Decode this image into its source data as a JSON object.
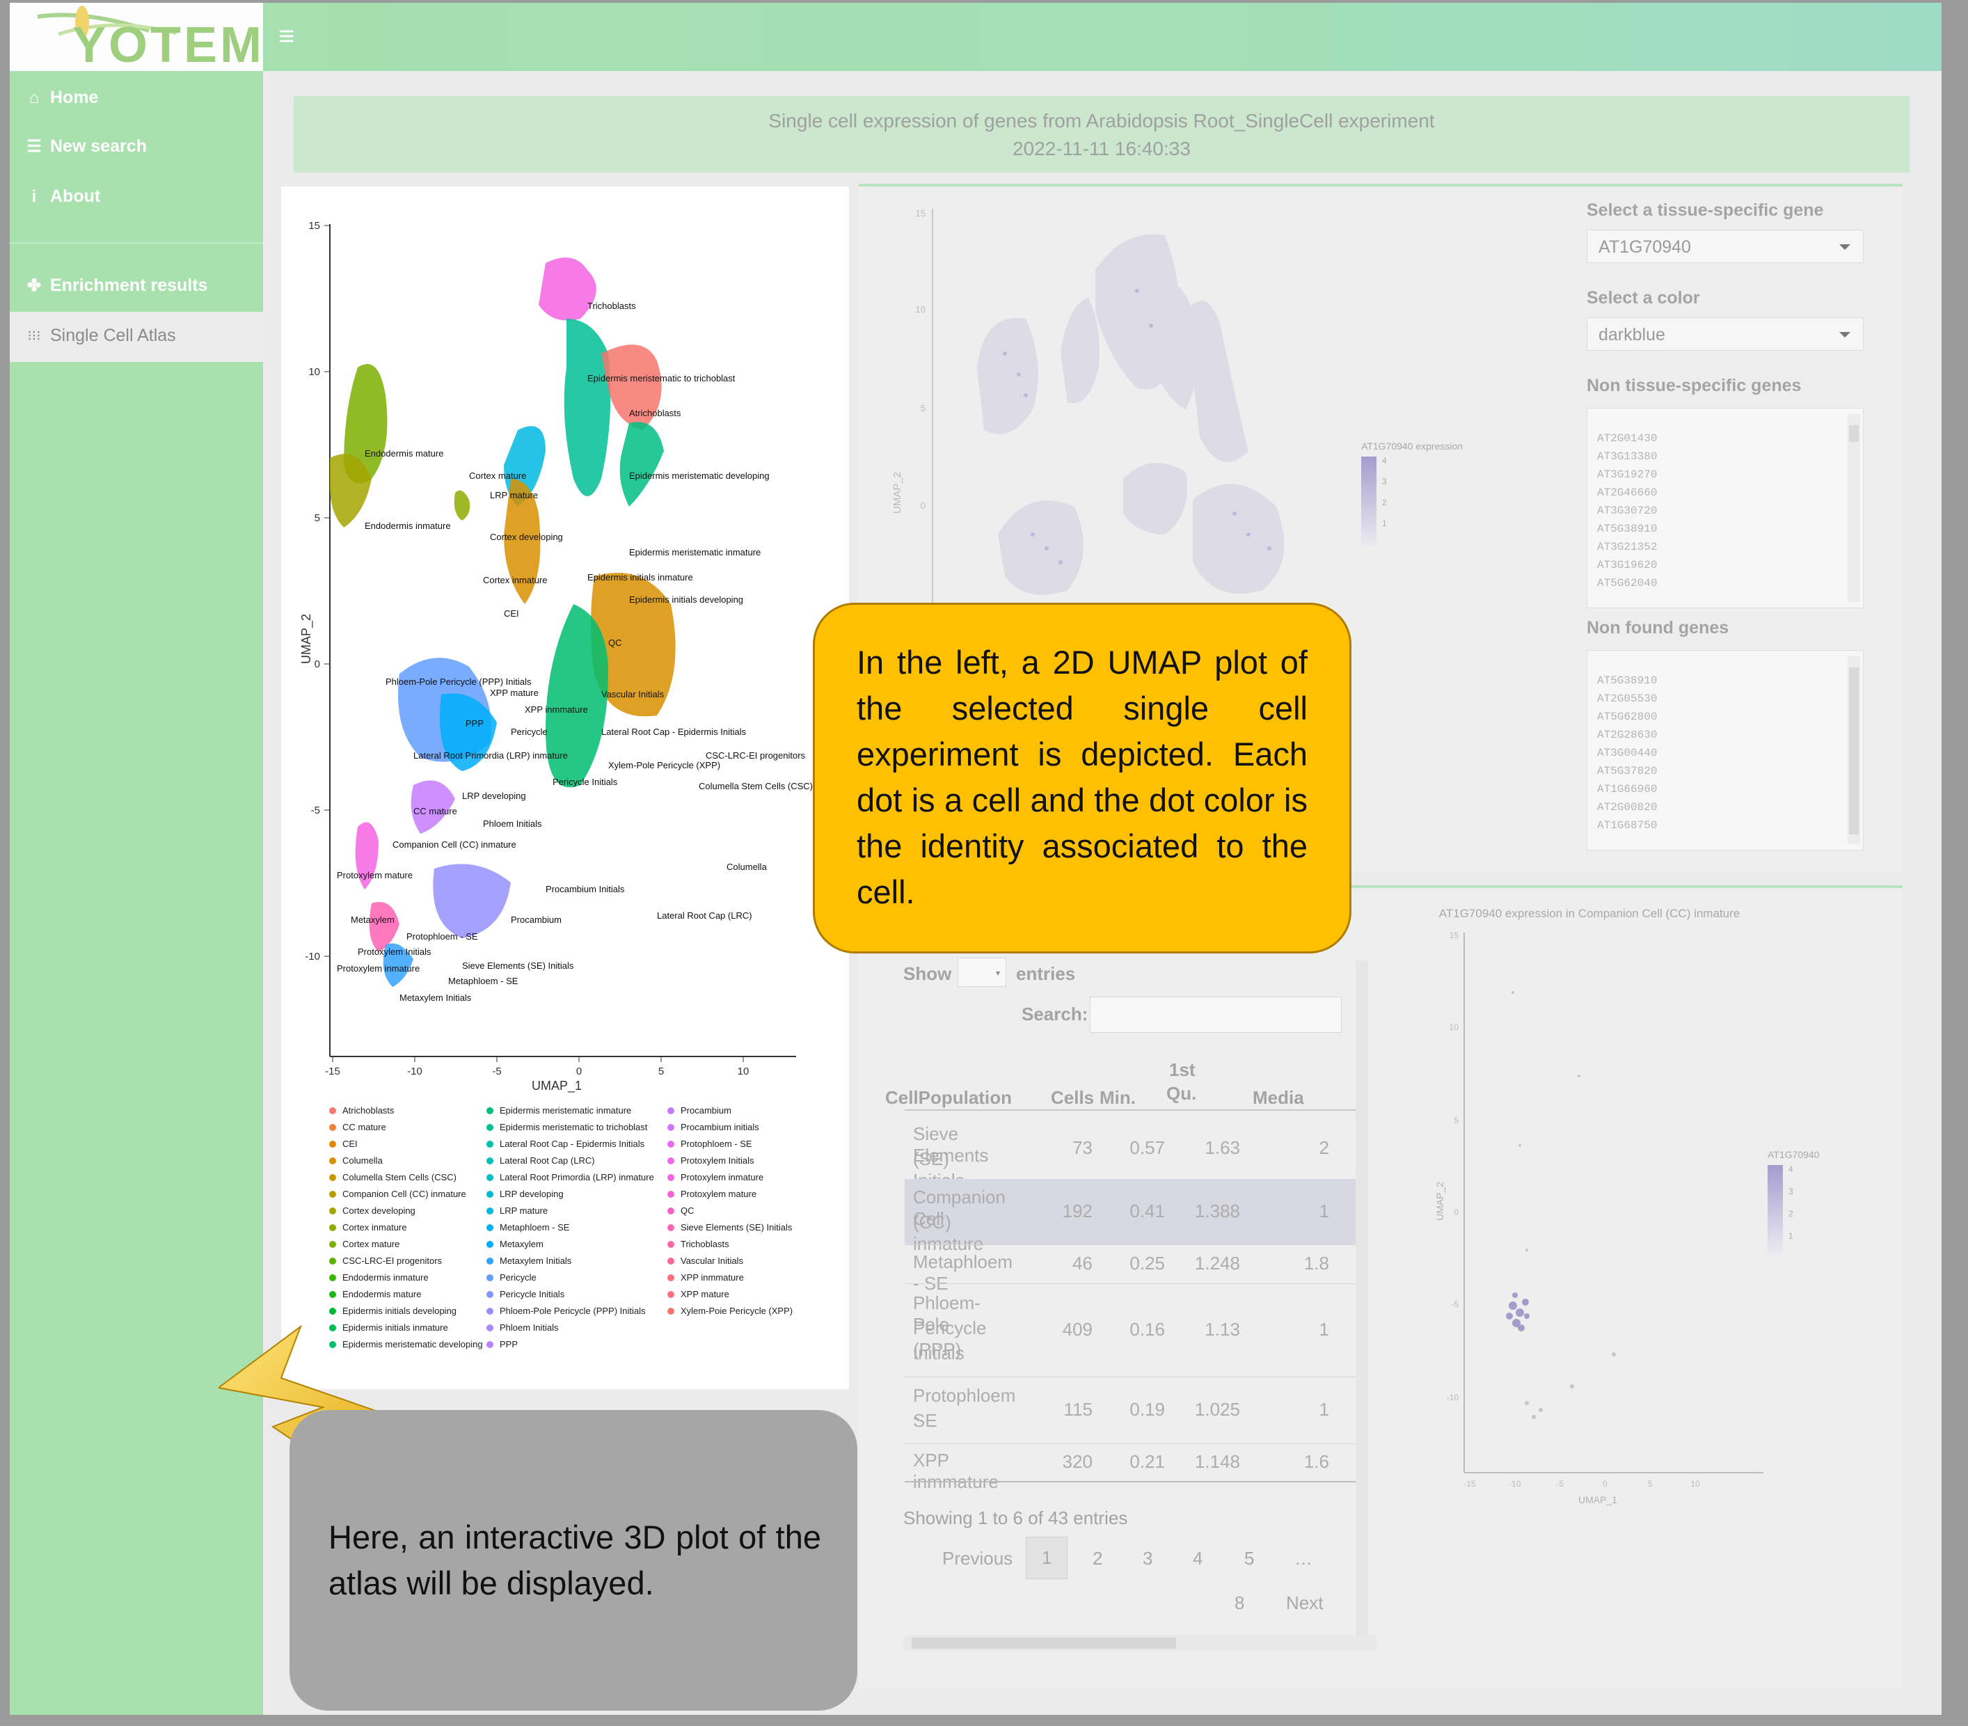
{
  "app": {
    "logo": "YOTEM",
    "menu_icon": "hamburger-icon"
  },
  "sidebar": {
    "items": [
      {
        "label": "Home",
        "icon": "home-icon"
      },
      {
        "label": "New search",
        "icon": "database-icon"
      },
      {
        "label": "About",
        "icon": "info-icon"
      },
      {
        "label": "Enrichment results",
        "icon": "sprout-icon"
      },
      {
        "label": "Single Cell Atlas",
        "icon": "dots-grid-icon"
      }
    ]
  },
  "header": {
    "title": "Single cell expression of genes from Arabidopsis Root_SingleCell experiment",
    "timestamp": "2022-11-11 16:40:33"
  },
  "umap2d": {
    "xlabel": "UMAP_1",
    "ylabel": "UMAP_2",
    "xticks": [
      "-15",
      "-10",
      "-5",
      "0",
      "5",
      "10"
    ],
    "yticks": [
      "15",
      "10",
      "5",
      "0",
      "-5",
      "-10"
    ],
    "cluster_labels": [
      "Trichoblasts",
      "Epidermis meristematic to trichoblast",
      "Atrichoblasts",
      "Endodermis mature",
      "Cortex mature",
      "Epidermis meristematic developing",
      "LRP mature",
      "Endodermis inmature",
      "Cortex developing",
      "Epidermis meristematic inmature",
      "Cortex inmature",
      "Epidermis initials inmature",
      "Epidermis initials developing",
      "CEI",
      "QC",
      "Phloem-Pole Pericycle (PPP) Initials",
      "XPP mature",
      "Vascular Initials",
      "XPP inmmature",
      "PPP",
      "Pericycle",
      "Lateral Root Cap - Epidermis Initials",
      "CSC-LRC-EI progenitors",
      "Lateral Root Primordia (LRP) inmature",
      "Xylem-Pole Pericycle (XPP)",
      "Pericycle Initials",
      "Columella Stem Cells (CSC)",
      "LRP developing",
      "CC mature",
      "Phloem Initials",
      "Companion Cell (CC) inmature",
      "Columella",
      "Protoxylem mature",
      "Procambium Initials",
      "Lateral Root Cap (LRC)",
      "Metaxylem",
      "Procambium",
      "Protophloem - SE",
      "Protoxylem Initials",
      "Sieve Elements (SE) Initials",
      "Protoxylem inmature",
      "Metaphloem - SE",
      "Metaxylem Initials"
    ],
    "legend": {
      "col1": [
        {
          "label": "Atrichoblasts",
          "color": "#f8766d"
        },
        {
          "label": "CC mature",
          "color": "#f1803d"
        },
        {
          "label": "CEI",
          "color": "#e58700"
        },
        {
          "label": "Columella",
          "color": "#d89000"
        },
        {
          "label": "Columella Stem Cells (CSC)",
          "color": "#c99800"
        },
        {
          "label": "Companion Cell (CC) inmature",
          "color": "#b79f00"
        },
        {
          "label": "Cortex developing",
          "color": "#a3a500"
        },
        {
          "label": "Cortex inmature",
          "color": "#8eab00"
        },
        {
          "label": "Cortex mature",
          "color": "#7cae00"
        },
        {
          "label": "CSC-LRC-EI progenitors",
          "color": "#5bb300"
        },
        {
          "label": "Endodermis inmature",
          "color": "#39b600"
        },
        {
          "label": "Endodermis mature",
          "color": "#1fb812"
        },
        {
          "label": "Epidermis initials developing",
          "color": "#00ba38"
        },
        {
          "label": "Epidermis initials inmature",
          "color": "#00bc59"
        },
        {
          "label": "Epidermis meristematic developing",
          "color": "#00bd6f"
        }
      ],
      "col2": [
        {
          "label": "Epidermis meristematic inmature",
          "color": "#00be82"
        },
        {
          "label": "Epidermis meristematic to trichoblast",
          "color": "#00c094"
        },
        {
          "label": "Lateral Root Cap - Epidermis Initials",
          "color": "#00c0a6"
        },
        {
          "label": "Lateral Root Cap (LRC)",
          "color": "#00c0b8"
        },
        {
          "label": "Lateral Root Primordia (LRP) inmature",
          "color": "#00bfc4"
        },
        {
          "label": "LRP developing",
          "color": "#00bcd1"
        },
        {
          "label": "LRP mature",
          "color": "#00b9e3"
        },
        {
          "label": "Metaphloem - SE",
          "color": "#00b4ef"
        },
        {
          "label": "Metaxylem",
          "color": "#00adfa"
        },
        {
          "label": "Metaxylem Initials",
          "color": "#35a2ff"
        },
        {
          "label": "Pericycle",
          "color": "#619cff"
        },
        {
          "label": "Pericycle Initials",
          "color": "#7f96ff"
        },
        {
          "label": "Phloem-Pole Pericycle (PPP) Initials",
          "color": "#9590ff"
        },
        {
          "label": "Phloem Initials",
          "color": "#a58aff"
        },
        {
          "label": "PPP",
          "color": "#b983ff"
        }
      ],
      "col3": [
        {
          "label": "Procambium",
          "color": "#c77cff"
        },
        {
          "label": "Procambium initials",
          "color": "#d376ff"
        },
        {
          "label": "Protophloem - SE",
          "color": "#e76bf3"
        },
        {
          "label": "Protoxylem Initials",
          "color": "#ef67eb"
        },
        {
          "label": "Protoxylem inmature",
          "color": "#f564e3"
        },
        {
          "label": "Protoxylem mature",
          "color": "#fa62d4"
        },
        {
          "label": "QC",
          "color": "#fd61c4"
        },
        {
          "label": "Sieve Elements (SE) Initials",
          "color": "#ff61b4"
        },
        {
          "label": "Trichoblasts",
          "color": "#ff64a3"
        },
        {
          "label": "Vascular Initials",
          "color": "#ff6792"
        },
        {
          "label": "XPP inmmature",
          "color": "#fe6d80"
        },
        {
          "label": "XPP mature",
          "color": "#fc717f"
        },
        {
          "label": "Xylem-Poie Pericycle (XPP)",
          "color": "#f8766d"
        }
      ]
    }
  },
  "expression_plot": {
    "ylabel": "UMAP_2",
    "yticks": [
      "15",
      "10",
      "5",
      "0"
    ],
    "legend_title": "AT1G70940 expression",
    "legend_values": [
      "4",
      "3",
      "2",
      "1"
    ]
  },
  "controls": {
    "gene_label": "Select a tissue-specific gene",
    "gene_value": "AT1G70940",
    "color_label": "Select a color",
    "color_value": "darkblue",
    "non_specific_label": "Non tissue-specific genes",
    "non_specific_genes": [
      "AT2G01430",
      "AT3G13380",
      "AT3G19270",
      "AT2G46660",
      "AT3G30720",
      "AT5G38910",
      "AT3G21352",
      "AT3G19620",
      "AT5G62040"
    ],
    "non_found_label": "Non found genes",
    "non_found_genes": [
      "AT5G38910",
      "AT2G05530",
      "AT5G62800",
      "AT2G28630",
      "AT3G00440",
      "AT5G37820",
      "AT1G66960",
      "AT2G00820",
      "AT1G68750"
    ]
  },
  "table": {
    "show_label": "Show",
    "entries_label": "entries",
    "search_label": "Search:",
    "headers": [
      "CellPopulation",
      "Cells",
      "Min.",
      "1st Qu.",
      "Media"
    ],
    "rows": [
      {
        "pop": [
          "Sieve Elements",
          "(SE) Initials"
        ],
        "cells": "73",
        "min": "0.57",
        "q1": "1.63",
        "med": "2"
      },
      {
        "pop": [
          "Companion Cell",
          "(CC) inmature"
        ],
        "cells": "192",
        "min": "0.41",
        "q1": "1.388",
        "med": "1"
      },
      {
        "pop": [
          "Metaphloem - SE"
        ],
        "cells": "46",
        "min": "0.25",
        "q1": "1.248",
        "med": "1.8"
      },
      {
        "pop": [
          "Phloem-Pole",
          "Pericycle (PPP)",
          "Initials"
        ],
        "cells": "409",
        "min": "0.16",
        "q1": "1.13",
        "med": "1"
      },
      {
        "pop": [
          "Protophloem -",
          "SE"
        ],
        "cells": "115",
        "min": "0.19",
        "q1": "1.025",
        "med": "1"
      },
      {
        "pop": [
          "XPP inmmature"
        ],
        "cells": "320",
        "min": "0.21",
        "q1": "1.148",
        "med": "1.6"
      }
    ],
    "info": "Showing 1 to 6 of 43 entries",
    "previous": "Previous",
    "pages": [
      "1",
      "2",
      "3",
      "4",
      "5",
      "…",
      "8"
    ],
    "next": "Next"
  },
  "small_plot": {
    "title": "AT1G70940 expression in Companion Cell (CC) inmature",
    "xlabel": "UMAP_1",
    "ylabel": "UMAP_2",
    "xticks": [
      "-15",
      "-10",
      "-5",
      "0",
      "5",
      "10"
    ],
    "yticks": [
      "15",
      "10",
      "5",
      "0",
      "-5",
      "-10"
    ],
    "legend_title": "AT1G70940 expression",
    "legend_values": [
      "4",
      "3",
      "2",
      "1"
    ]
  },
  "callouts": {
    "left_umap": "In the left, a 2D UMAP plot of the selected single cell experiment is depicted. Each dot is a cell and the dot color is the identity associated to the cell.",
    "atlas_3d": "Here, an interactive 3D plot of the atlas will be displayed."
  }
}
